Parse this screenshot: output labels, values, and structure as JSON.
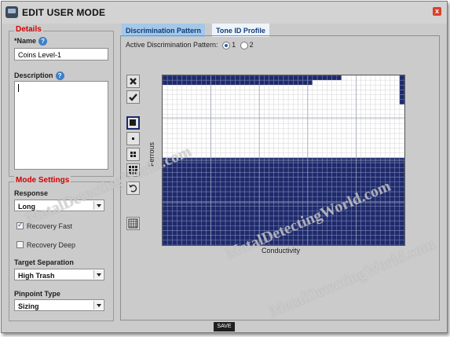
{
  "window": {
    "title": "EDIT USER MODE",
    "close_label": "x"
  },
  "details": {
    "legend": "Details",
    "name_label": "*Name",
    "name_value": "Coins Level-1",
    "description_label": "Description",
    "description_value": "",
    "help_glyph": "?"
  },
  "mode_settings": {
    "legend": "Mode Settings",
    "response_label": "Response",
    "response_value": "Long",
    "recovery_fast_label": "Recovery Fast",
    "recovery_fast_checked": true,
    "recovery_deep_label": "Recovery Deep",
    "recovery_deep_checked": false,
    "target_sep_label": "Target Separation",
    "target_sep_value": "High Trash",
    "pinpoint_label": "Pinpoint Type",
    "pinpoint_value": "Sizing"
  },
  "tabs": [
    {
      "label": "Discrimination Pattern",
      "active": true
    },
    {
      "label": "Tone ID Profile",
      "active": false
    }
  ],
  "pattern": {
    "active_label": "Active Discrimination Pattern:",
    "options": [
      "1",
      "2"
    ],
    "selected": "1",
    "xlabel": "Conductivity",
    "ylabel": "Ferrous",
    "grid": {
      "cols": 50,
      "rows": 35,
      "fill_color": "#1e2a6b",
      "empty_color": "#ffffff",
      "top_row_filled_to_col": 37,
      "second_row_filled_to_col": 31,
      "right_column_filled_rows": 6,
      "solid_from_row": 17
    }
  },
  "tools": [
    "reject-icon",
    "accept-icon",
    "brush-large-icon",
    "brush-small-icon",
    "brush-medium-icon",
    "brush-grid-icon",
    "undo-icon",
    "fill-all-icon"
  ],
  "save_label": "SAVE",
  "watermarks": [
    "MetalDetectingWorld.com",
    "MetalDetectingWorld.com",
    "MetalDetectingWorld.com"
  ]
}
